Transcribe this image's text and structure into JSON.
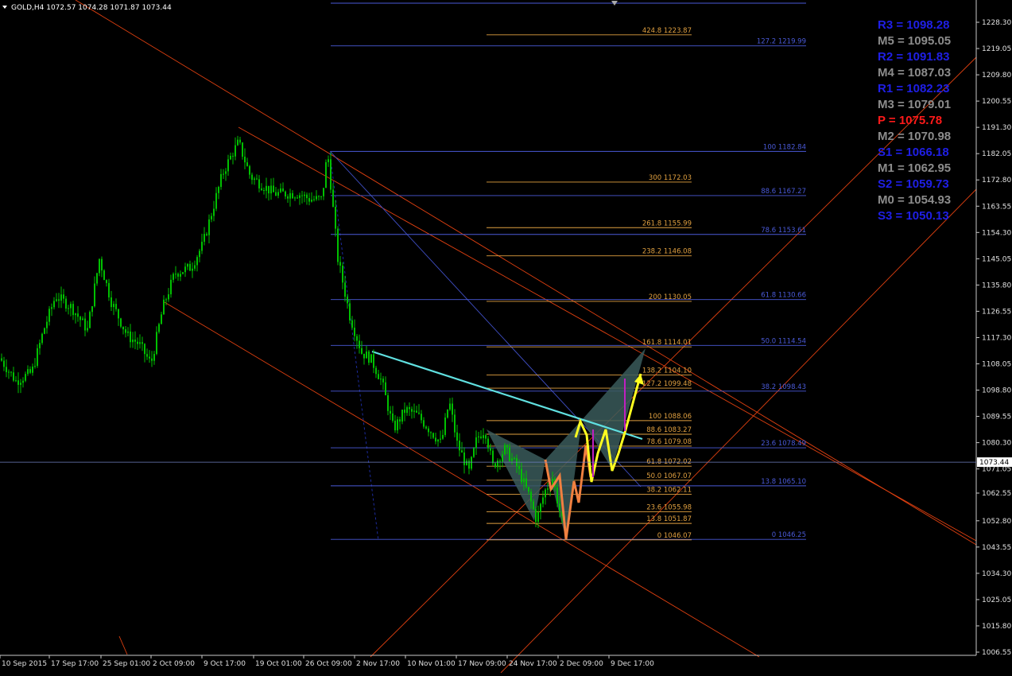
{
  "chart_data": {
    "type": "candlestick",
    "symbol_header": "GOLD,H4  1072.57 1074.28 1071.87 1073.44",
    "current_price": "1073.44",
    "ylim": [
      1006.55,
      1237.0
    ],
    "y_ticks": [
      "1228.30",
      "1219.05",
      "1209.80",
      "1200.55",
      "1191.30",
      "1182.05",
      "1172.80",
      "1163.55",
      "1154.30",
      "1145.05",
      "1135.80",
      "1126.55",
      "1117.30",
      "1108.05",
      "1098.80",
      "1089.55",
      "1080.30",
      "1071.05",
      "1062.55",
      "1052.80",
      "1043.55",
      "1034.30",
      "1025.05",
      "1015.80",
      "1006.55"
    ],
    "x_ticks": [
      "10 Sep 2015",
      "17 Sep 17:00",
      "25 Sep 01:00",
      "2 Oct 09:00",
      "9 Oct 17:00",
      "19 Oct 01:00",
      "26 Oct 09:00",
      "2 Nov 17:00",
      "10 Nov 01:00",
      "17 Nov 09:00",
      "24 Nov 17:00",
      "2 Dec 09:00",
      "9 Dec 17:00"
    ],
    "fib_levels_left": [
      {
        "label": "127.2 1219.99",
        "value": 1219.99
      },
      {
        "label": "100 1182.84",
        "value": 1182.84
      },
      {
        "label": "88.6 1167.27",
        "value": 1167.27
      },
      {
        "label": "78.6 1153.61",
        "value": 1153.61
      },
      {
        "label": "61.8 1130.66",
        "value": 1130.66
      },
      {
        "label": "50.0 1114.54",
        "value": 1114.54
      },
      {
        "label": "38.2 1098.43",
        "value": 1098.43
      },
      {
        "label": "23.6 1078.49",
        "value": 1078.49
      },
      {
        "label": "13.8 1065.10",
        "value": 1065.1
      },
      {
        "label": "0 1046.25",
        "value": 1046.25
      }
    ],
    "fib_levels_right": [
      {
        "label": "424.8 1223.87",
        "value": 1223.87
      },
      {
        "label": "300 1172.03",
        "value": 1172.03
      },
      {
        "label": "261.8 1155.99",
        "value": 1155.99
      },
      {
        "label": "238.2 1146.08",
        "value": 1146.08
      },
      {
        "label": "200 1130.05",
        "value": 1130.05
      },
      {
        "label": "161.8 1114.01",
        "value": 1114.01
      },
      {
        "label": "138.2 1104.10",
        "value": 1104.1
      },
      {
        "label": "127.2 1099.48",
        "value": 1099.48
      },
      {
        "label": "100 1088.06",
        "value": 1088.06
      },
      {
        "label": "88.6 1083.27",
        "value": 1083.27
      },
      {
        "label": "78.6 1079.08",
        "value": 1079.08
      },
      {
        "label": "61.8 1072.02",
        "value": 1072.02
      },
      {
        "label": "50.0 1067.07",
        "value": 1067.07
      },
      {
        "label": "38.2 1062.11",
        "value": 1062.11
      },
      {
        "label": "23.6 1055.98",
        "value": 1055.98
      },
      {
        "label": "13.8 1051.87",
        "value": 1051.87
      },
      {
        "label": "0 1046.07",
        "value": 1046.07
      }
    ],
    "pivots": [
      {
        "label": "R3 = 1098.28",
        "color": "#1f1fe6"
      },
      {
        "label": "M5 = 1095.05",
        "color": "#8c8c8c"
      },
      {
        "label": "R2 = 1091.83",
        "color": "#1f1fe6"
      },
      {
        "label": "M4 = 1087.03",
        "color": "#8c8c8c"
      },
      {
        "label": "R1 = 1082.23",
        "color": "#1f1fe6"
      },
      {
        "label": "M3 = 1079.01",
        "color": "#8c8c8c"
      },
      {
        "label": "P   = 1075.78",
        "color": "#ff1a1a"
      },
      {
        "label": "M2 = 1070.98",
        "color": "#8c8c8c"
      },
      {
        "label": "S1 = 1066.18",
        "color": "#1f1fe6"
      },
      {
        "label": "M1 = 1062.95",
        "color": "#8c8c8c"
      },
      {
        "label": "S2 = 1059.73",
        "color": "#1f1fe6"
      },
      {
        "label": "M0 = 1054.93",
        "color": "#8c8c8c"
      },
      {
        "label": "S3 = 1050.13",
        "color": "#1f1fe6"
      }
    ],
    "colors": {
      "candle": "#00c000",
      "fib_blue": "#4a5ad8",
      "fib_orange": "#e0a040",
      "channel": "#e04010",
      "trend_cyan": "#60e0e0",
      "pattern_yellow": "#ffff20",
      "pattern_orange": "#f08040",
      "pattern_fill": "#3a5a5a",
      "magenta": "#c020c0",
      "axis_text": "#e0e0e0"
    }
  }
}
